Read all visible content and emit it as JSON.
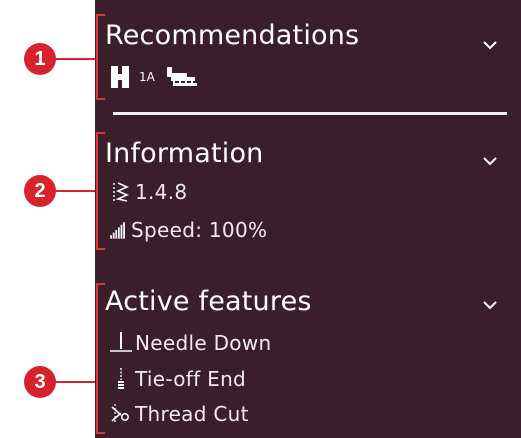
{
  "callouts": [
    "1",
    "2",
    "3"
  ],
  "sections": {
    "recommendations": {
      "title": "Recommendations",
      "presser_foot_label": "1A",
      "icons": [
        "presser-foot-icon",
        "stabilizer-icon"
      ]
    },
    "information": {
      "title": "Information",
      "stitch_setting": "1.4.8",
      "speed": "Speed: 100%",
      "icons": [
        "stitch-width-icon",
        "speed-icon"
      ]
    },
    "active_features": {
      "title": "Active features",
      "items": [
        {
          "label": "Needle Down",
          "icon": "needle-down-icon"
        },
        {
          "label": "Tie-off End",
          "icon": "tie-off-end-icon"
        },
        {
          "label": "Thread Cut",
          "icon": "thread-cut-icon"
        }
      ]
    }
  },
  "colors": {
    "panel_bg": "#3a1e2b",
    "callout_red": "#d6232d",
    "bracket_red": "#e0323c",
    "text": "#ffffff"
  }
}
